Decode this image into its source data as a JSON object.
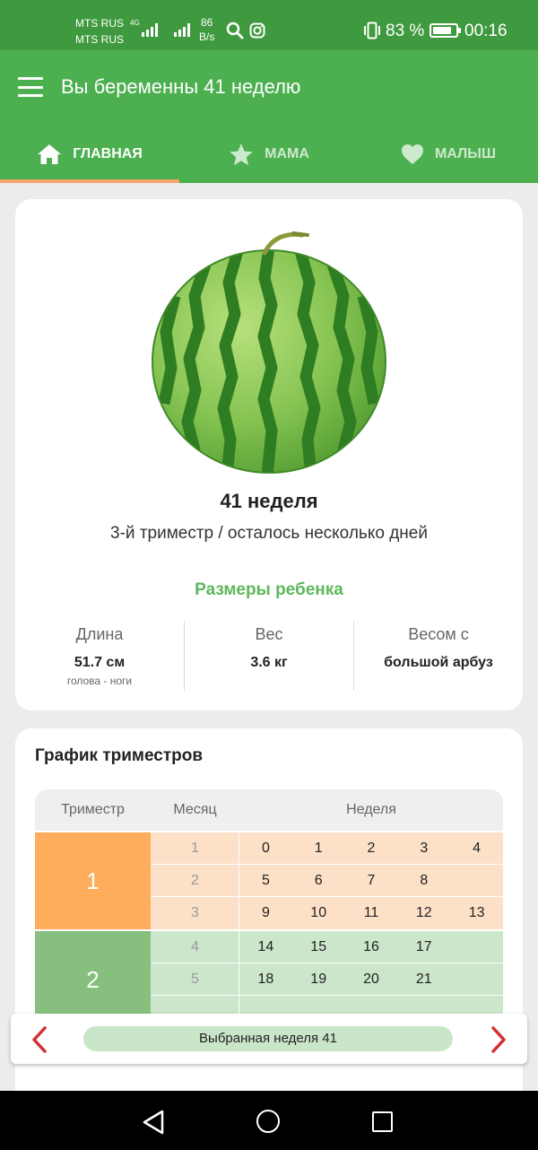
{
  "status_bar": {
    "carrier_1": "MTS RUS",
    "carrier_2": "MTS RUS",
    "network": "4G",
    "speed_value": "86",
    "speed_unit": "B/s",
    "battery_percent": "83 %",
    "battery_level": 0.83,
    "time": "00:16"
  },
  "app_bar": {
    "title": "Вы беременны 41 неделю",
    "tabs": [
      {
        "label": "ГЛАВНАЯ",
        "icon": "home-icon",
        "active": true
      },
      {
        "label": "МАМА",
        "icon": "star-icon",
        "active": false
      },
      {
        "label": "МАЛЫШ",
        "icon": "heart-icon",
        "active": false
      }
    ]
  },
  "baby_card": {
    "fruit_icon": "watermelon-image",
    "week_title": "41 неделя",
    "subtitle": "3-й триместр / осталось несколько дней",
    "sizes_title": "Размеры ребенка",
    "metrics": [
      {
        "label": "Длина",
        "value": "51.7 см",
        "sub": "голова - ноги"
      },
      {
        "label": "Вес",
        "value": "3.6 кг",
        "sub": ""
      },
      {
        "label": "Весом с",
        "value": "большой арбуз",
        "sub": ""
      }
    ]
  },
  "trimester_chart": {
    "title": "График триместров",
    "headers": {
      "trimester": "Триместр",
      "month": "Месяц",
      "week": "Неделя"
    },
    "trimesters": [
      {
        "number": "1",
        "color": "#fdad5c",
        "row_color": "#fde0c8",
        "rows": [
          {
            "month": "1",
            "weeks": [
              "0",
              "1",
              "2",
              "3",
              "4"
            ]
          },
          {
            "month": "2",
            "weeks": [
              "5",
              "6",
              "7",
              "8"
            ]
          },
          {
            "month": "3",
            "weeks": [
              "9",
              "10",
              "11",
              "12",
              "13"
            ]
          }
        ]
      },
      {
        "number": "2",
        "color": "#86bf7e",
        "row_color": "#cbe6cb",
        "rows": [
          {
            "month": "4",
            "weeks": [
              "14",
              "15",
              "16",
              "17"
            ]
          },
          {
            "month": "5",
            "weeks": [
              "18",
              "19",
              "20",
              "21"
            ]
          },
          {
            "month": "",
            "weeks": []
          }
        ]
      }
    ]
  },
  "week_selector": {
    "label": "Выбранная неделя 41",
    "prev_icon": "chevron-left-icon",
    "next_icon": "chevron-right-icon"
  },
  "colors": {
    "status_bar": "#3f9a3f",
    "app_bar": "#4caf50",
    "tab_indicator": "#f6a56a",
    "accent_red": "#d32f2f",
    "sizes_title": "#5cb85c"
  }
}
